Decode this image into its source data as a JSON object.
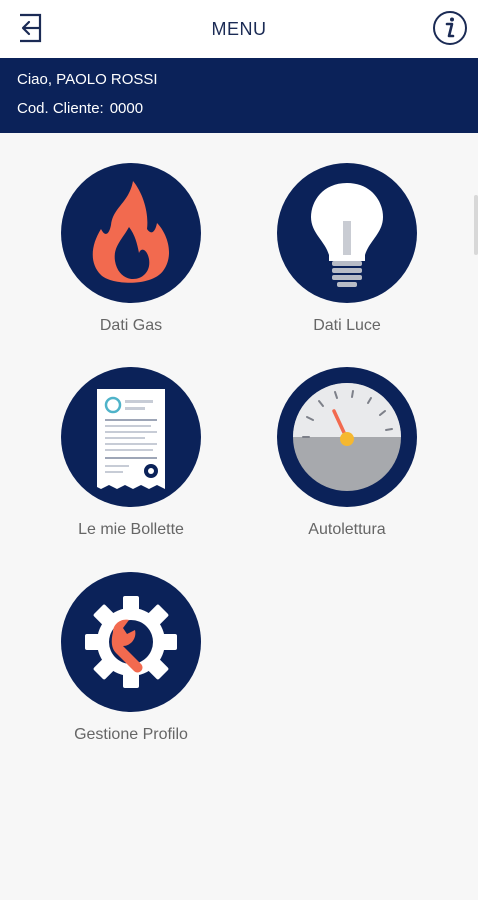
{
  "header": {
    "title": "MENU",
    "logout_icon": "logout-icon",
    "info_icon": "info-icon"
  },
  "user": {
    "greeting": "Ciao, PAOLO ROSSI",
    "code_label": "Cod. Cliente:",
    "code_value": "0000"
  },
  "menu": {
    "items": [
      {
        "label": "Dati Gas",
        "icon": "flame-icon"
      },
      {
        "label": "Dati Luce",
        "icon": "lightbulb-icon"
      },
      {
        "label": "Le mie Bollette",
        "icon": "bill-document-icon"
      },
      {
        "label": "Autolettura",
        "icon": "meter-gauge-icon"
      },
      {
        "label": "Gestione Profilo",
        "icon": "gear-wrench-icon"
      }
    ]
  },
  "colors": {
    "brand_navy": "#0b2259",
    "accent_orange": "#f26a4f",
    "label_gray": "#666666",
    "background": "#f7f7f7"
  }
}
